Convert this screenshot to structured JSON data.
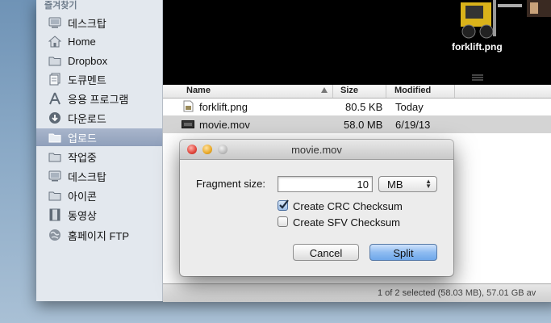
{
  "sidebar": {
    "header": "즐겨찾기",
    "items": [
      {
        "label": "데스크탑",
        "icon": "desktop-icon"
      },
      {
        "label": "Home",
        "icon": "home-icon"
      },
      {
        "label": "Dropbox",
        "icon": "folder-icon"
      },
      {
        "label": "도큐멘트",
        "icon": "documents-icon"
      },
      {
        "label": "응용 프로그램",
        "icon": "applications-icon"
      },
      {
        "label": "다운로드",
        "icon": "download-icon"
      },
      {
        "label": "업로드",
        "icon": "folder-icon"
      },
      {
        "label": "작업중",
        "icon": "folder-icon"
      },
      {
        "label": "데스크탑",
        "icon": "desktop-icon"
      },
      {
        "label": "아이콘",
        "icon": "folder-icon"
      },
      {
        "label": "동영상",
        "icon": "movies-icon"
      },
      {
        "label": "홈페이지 FTP",
        "icon": "globe-icon"
      }
    ],
    "selected_index": 6
  },
  "preview": {
    "filename": "forklift.png"
  },
  "file_list": {
    "columns": {
      "name": "Name",
      "size": "Size",
      "modified": "Modified"
    },
    "rows": [
      {
        "name": "forklift.png",
        "size": "80.5 KB",
        "modified": "Today",
        "icon": "image-file-icon"
      },
      {
        "name": "movie.mov",
        "size": "58.0 MB",
        "modified": "6/19/13",
        "icon": "movie-file-icon"
      }
    ],
    "selected_row": 1
  },
  "status_bar": {
    "text": "1 of 2 selected  (58.03 MB), 57.01 GB av"
  },
  "dialog": {
    "title": "movie.mov",
    "fragment_label": "Fragment size:",
    "fragment_value": "10",
    "unit_selected": "MB",
    "crc_label": "Create CRC Checksum",
    "crc_checked": true,
    "sfv_label": "Create SFV Checksum",
    "sfv_checked": false,
    "cancel_label": "Cancel",
    "split_label": "Split"
  },
  "colors": {
    "accent": "#6ea7ea",
    "selection": "#8f9fba"
  }
}
